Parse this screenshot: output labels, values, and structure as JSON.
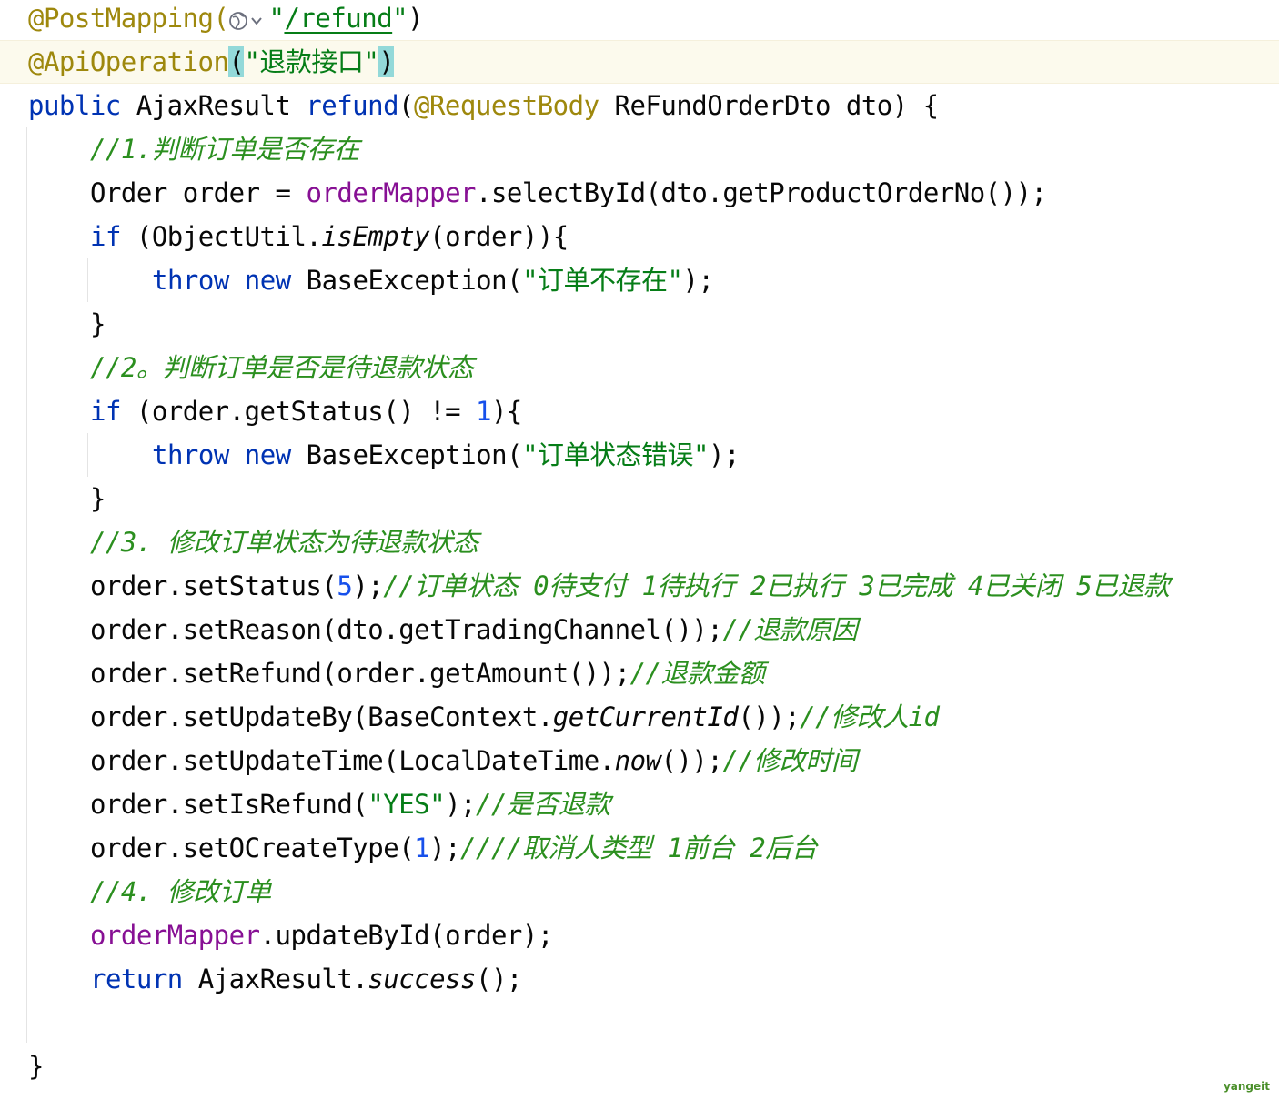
{
  "editor": {
    "theme_colors": {
      "annotation": "#9e880d",
      "keyword": "#0033b3",
      "member": "#871094",
      "number": "#1750eb",
      "string": "#067d17",
      "comment": "#2b8f1f",
      "current_line_bg": "#fcfaed",
      "brace_match_bg": "#93d9d9"
    },
    "lines": [
      {
        "indent": 1,
        "tokens": [
          {
            "t": "@PostMapping(",
            "c": "annotation"
          },
          {
            "icon": "globe-dropdown-icon"
          },
          {
            "t": "\"",
            "c": "string"
          },
          {
            "t": "/refund",
            "c": "string-ul"
          },
          {
            "t": "\"",
            "c": "string"
          },
          {
            "t": ")",
            "c": "plain"
          }
        ]
      },
      {
        "indent": 1,
        "current": true,
        "tokens": [
          {
            "t": "@ApiOperation",
            "c": "annotation"
          },
          {
            "t": "(",
            "c": "brace"
          },
          {
            "t": "\"退款接口\"",
            "c": "string"
          },
          {
            "t": ")",
            "c": "brace"
          }
        ]
      },
      {
        "indent": 1,
        "tokens": [
          {
            "t": "public",
            "c": "keyword"
          },
          {
            "t": " AjaxResult ",
            "c": "plain"
          },
          {
            "t": "refund",
            "c": "keyword"
          },
          {
            "t": "(",
            "c": "plain"
          },
          {
            "t": "@RequestBody",
            "c": "annotation"
          },
          {
            "t": " ReFundOrderDto dto) {",
            "c": "plain"
          }
        ]
      },
      {
        "indent": 3,
        "tokens": [
          {
            "t": "//1.判断订单是否存在",
            "c": "comment"
          }
        ]
      },
      {
        "indent": 3,
        "tokens": [
          {
            "t": "Order order = ",
            "c": "plain"
          },
          {
            "t": "orderMapper",
            "c": "member"
          },
          {
            "t": ".selectById(dto.getProductOrderNo());",
            "c": "plain"
          }
        ]
      },
      {
        "indent": 3,
        "tokens": [
          {
            "t": "if",
            "c": "keyword"
          },
          {
            "t": " (ObjectUtil.",
            "c": "plain"
          },
          {
            "t": "isEmpty",
            "c": "italic"
          },
          {
            "t": "(order)){",
            "c": "plain"
          }
        ]
      },
      {
        "indent": 5,
        "tokens": [
          {
            "t": "throw",
            "c": "keyword"
          },
          {
            "t": " ",
            "c": "plain"
          },
          {
            "t": "new",
            "c": "keyword"
          },
          {
            "t": " BaseException(",
            "c": "plain"
          },
          {
            "t": "\"订单不存在\"",
            "c": "string"
          },
          {
            "t": ");",
            "c": "plain"
          }
        ]
      },
      {
        "indent": 3,
        "tokens": [
          {
            "t": "}",
            "c": "plain"
          }
        ]
      },
      {
        "indent": 3,
        "tokens": [
          {
            "t": "//2。判断订单是否是待退款状态",
            "c": "comment"
          }
        ]
      },
      {
        "indent": 3,
        "tokens": [
          {
            "t": "if",
            "c": "keyword"
          },
          {
            "t": " (order.getStatus() != ",
            "c": "plain"
          },
          {
            "t": "1",
            "c": "number"
          },
          {
            "t": "){",
            "c": "plain"
          }
        ]
      },
      {
        "indent": 5,
        "tokens": [
          {
            "t": "throw",
            "c": "keyword"
          },
          {
            "t": " ",
            "c": "plain"
          },
          {
            "t": "new",
            "c": "keyword"
          },
          {
            "t": " BaseException(",
            "c": "plain"
          },
          {
            "t": "\"订单状态错误\"",
            "c": "string"
          },
          {
            "t": ");",
            "c": "plain"
          }
        ]
      },
      {
        "indent": 3,
        "tokens": [
          {
            "t": "}",
            "c": "plain"
          }
        ]
      },
      {
        "indent": 3,
        "tokens": [
          {
            "t": "//3. 修改订单状态为待退款状态",
            "c": "comment"
          }
        ]
      },
      {
        "indent": 3,
        "tokens": [
          {
            "t": "order.setStatus(",
            "c": "plain"
          },
          {
            "t": "5",
            "c": "number"
          },
          {
            "t": ");",
            "c": "plain"
          },
          {
            "t": "//订单状态 0待支付 1待执行 2已执行 3已完成 4已关闭 5已退款",
            "c": "comment"
          }
        ]
      },
      {
        "indent": 3,
        "tokens": [
          {
            "t": "order.setReason(dto.getTradingChannel());",
            "c": "plain"
          },
          {
            "t": "//退款原因",
            "c": "comment"
          }
        ]
      },
      {
        "indent": 3,
        "tokens": [
          {
            "t": "order.setRefund(order.getAmount());",
            "c": "plain"
          },
          {
            "t": "//退款金额",
            "c": "comment"
          }
        ]
      },
      {
        "indent": 3,
        "tokens": [
          {
            "t": "order.setUpdateBy(BaseContext.",
            "c": "plain"
          },
          {
            "t": "getCurrentId",
            "c": "italic"
          },
          {
            "t": "());",
            "c": "plain"
          },
          {
            "t": "//修改人id",
            "c": "comment"
          }
        ]
      },
      {
        "indent": 3,
        "tokens": [
          {
            "t": "order.setUpdateTime(LocalDateTime.",
            "c": "plain"
          },
          {
            "t": "now",
            "c": "italic"
          },
          {
            "t": "());",
            "c": "plain"
          },
          {
            "t": "//修改时间",
            "c": "comment"
          }
        ]
      },
      {
        "indent": 3,
        "tokens": [
          {
            "t": "order.setIsRefund(",
            "c": "plain"
          },
          {
            "t": "\"YES\"",
            "c": "string"
          },
          {
            "t": ");",
            "c": "plain"
          },
          {
            "t": "//是否退款",
            "c": "comment"
          }
        ]
      },
      {
        "indent": 3,
        "tokens": [
          {
            "t": "order.setOCreateType(",
            "c": "plain"
          },
          {
            "t": "1",
            "c": "number"
          },
          {
            "t": ");",
            "c": "plain"
          },
          {
            "t": "////取消人类型 1前台 2后台",
            "c": "comment"
          }
        ]
      },
      {
        "indent": 3,
        "tokens": [
          {
            "t": "//4. 修改订单",
            "c": "comment"
          }
        ]
      },
      {
        "indent": 3,
        "tokens": [
          {
            "t": "orderMapper",
            "c": "member"
          },
          {
            "t": ".updateById(order);",
            "c": "plain"
          }
        ]
      },
      {
        "indent": 3,
        "tokens": [
          {
            "t": "return",
            "c": "keyword"
          },
          {
            "t": " AjaxResult.",
            "c": "plain"
          },
          {
            "t": "success",
            "c": "italic"
          },
          {
            "t": "();",
            "c": "plain"
          }
        ]
      },
      {
        "indent": 1,
        "tokens": []
      },
      {
        "indent": 1,
        "tokens": [
          {
            "t": "}",
            "c": "plain"
          }
        ]
      }
    ]
  },
  "watermark": "yangeit"
}
